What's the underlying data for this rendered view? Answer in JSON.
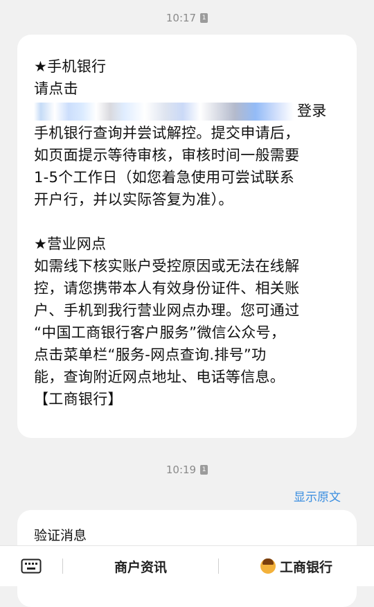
{
  "messages": [
    {
      "time": "10:17",
      "sim_icon": "sim-card-1-icon",
      "lines": [
        "★手机银行",
        "请点击",
        "登录",
        "手机银行查询并尝试解控。提交申请后，",
        "如页面提示等待审核，审核时间一般需要",
        "1-5个工作日（如您着急使用可尝试联系",
        "开户行，并以实际答复为准）。",
        "★营业网点",
        "如需线下核实账户受控原因或无法在线解",
        "控，请您携带本人有效身份证件、相关账",
        "户、手机到我行营业网点办理。您可通过",
        "“中国工商银行客户服务”微信公众号，",
        "点击菜单栏“服务-网点查询.排号”功",
        "能，查询附近网点地址、电话等信息。",
        "【工商银行】"
      ]
    },
    {
      "time": "10:19",
      "sim_icon": "sim-card-1-icon",
      "show_original": "显示原文",
      "preview_text": "验证消息"
    }
  ],
  "bottom_bar": {
    "keyboard_icon": "keyboard-icon",
    "menu_1": "商户资讯",
    "menu_2": "工商银行",
    "menu_2_icon": "person-emoji-icon"
  },
  "colors": {
    "background": "#f1f1f1",
    "bubble": "#ffffff",
    "link": "#3a8ee0",
    "timestamp": "#8a8a8a"
  }
}
